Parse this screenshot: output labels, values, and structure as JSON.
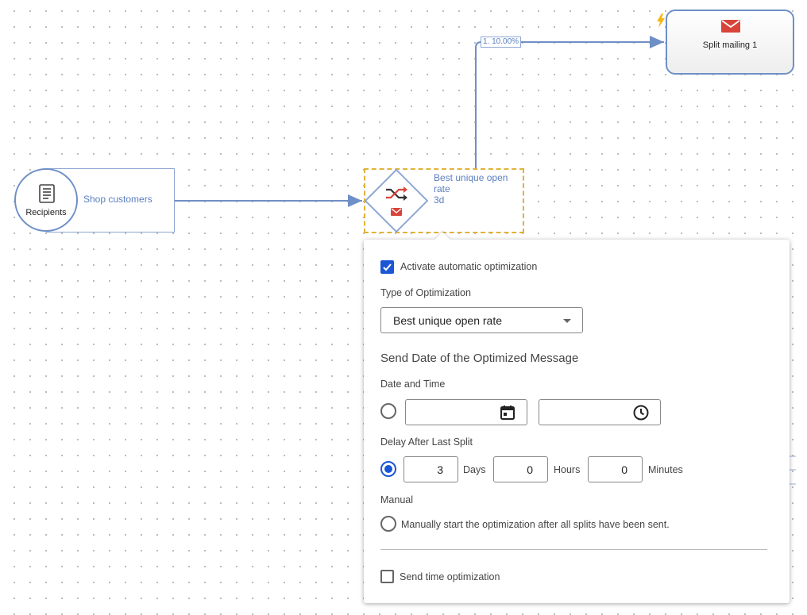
{
  "workflow": {
    "recipients_node": {
      "label": "Recipients",
      "icon": "list-document-icon"
    },
    "recipients_target": {
      "text": "Shop customers"
    },
    "split_mailing_node": {
      "label": "Split mailing 1",
      "icon": "envelope-icon",
      "trigger_icon": "lightning-icon"
    },
    "connection_label": "1. 10.00%",
    "optimization_node": {
      "icon": "shuffle-icon",
      "sub_icon": "envelope-icon",
      "line1": "Best unique open",
      "line2": "rate",
      "line3": "3d"
    }
  },
  "panel": {
    "activate": {
      "label": "Activate automatic optimization",
      "checked": true
    },
    "type_label": "Type of Optimization",
    "type_value": "Best unique open rate",
    "send_date_title": "Send Date of the Optimized Message",
    "date_time_label": "Date and Time",
    "date_value": "",
    "time_value": "",
    "delay_label": "Delay After Last Split",
    "delay": {
      "days": "3",
      "days_label": "Days",
      "hours": "0",
      "hours_label": "Hours",
      "minutes": "0",
      "minutes_label": "Minutes"
    },
    "manual_label": "Manual",
    "manual_option": "Manually start the optimization after all splits have been sent.",
    "send_time_label": "Send time optimization",
    "send_time_checked": false
  },
  "colors": {
    "accent": "#1a56d6",
    "connector": "#6f8fc7",
    "selection": "#e0b23a",
    "mail_red": "#d9443a"
  }
}
